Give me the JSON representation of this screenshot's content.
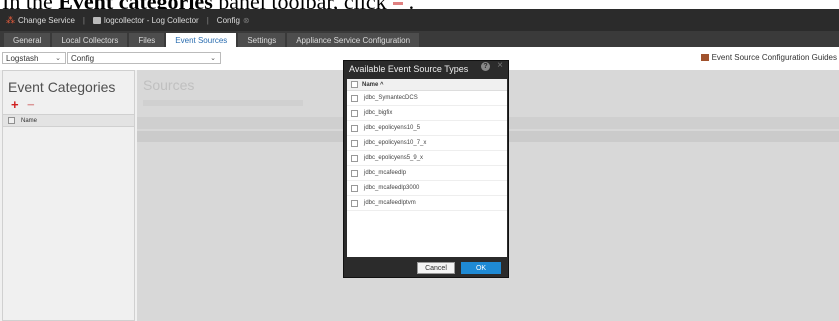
{
  "instruction": {
    "prefix": "In the ",
    "bold": "Event categories",
    "suffix": " panel toolbar, click",
    "end": "."
  },
  "titlebar": {
    "change_service": "Change Service",
    "service_name": "logcollector - Log Collector",
    "config": "Config"
  },
  "tabs": [
    {
      "label": "General",
      "active": false
    },
    {
      "label": "Local Collectors",
      "active": false
    },
    {
      "label": "Files",
      "active": false
    },
    {
      "label": "Event Sources",
      "active": true
    },
    {
      "label": "Settings",
      "active": false
    },
    {
      "label": "Appliance Service Configuration",
      "active": false
    }
  ],
  "filters": {
    "collector": "Logstash",
    "mode": "Config"
  },
  "guides_link": "Event Source Configuration Guides",
  "left_panel": {
    "title": "Event Categories",
    "column_header": "Name"
  },
  "right_panel": {
    "title": "Sources"
  },
  "modal": {
    "title": "Available Event Source Types",
    "column_header": "Name ^",
    "items": [
      "jdbc_SymantecDCS",
      "jdbc_bigfix",
      "jdbc_epolicyens10_5",
      "jdbc_epolicyens10_7_x",
      "jdbc_epolicyens5_9_x",
      "jdbc_mcafeedlp",
      "jdbc_mcafeedlp3000",
      "jdbc_mcafeedlptvm"
    ],
    "cancel_label": "Cancel",
    "ok_label": "OK"
  },
  "colors": {
    "titlebar_bg": "#2b2b2b",
    "tab_active_text": "#2a6db0",
    "ok_button": "#1f8ad4",
    "add_icon": "#dd2222"
  }
}
